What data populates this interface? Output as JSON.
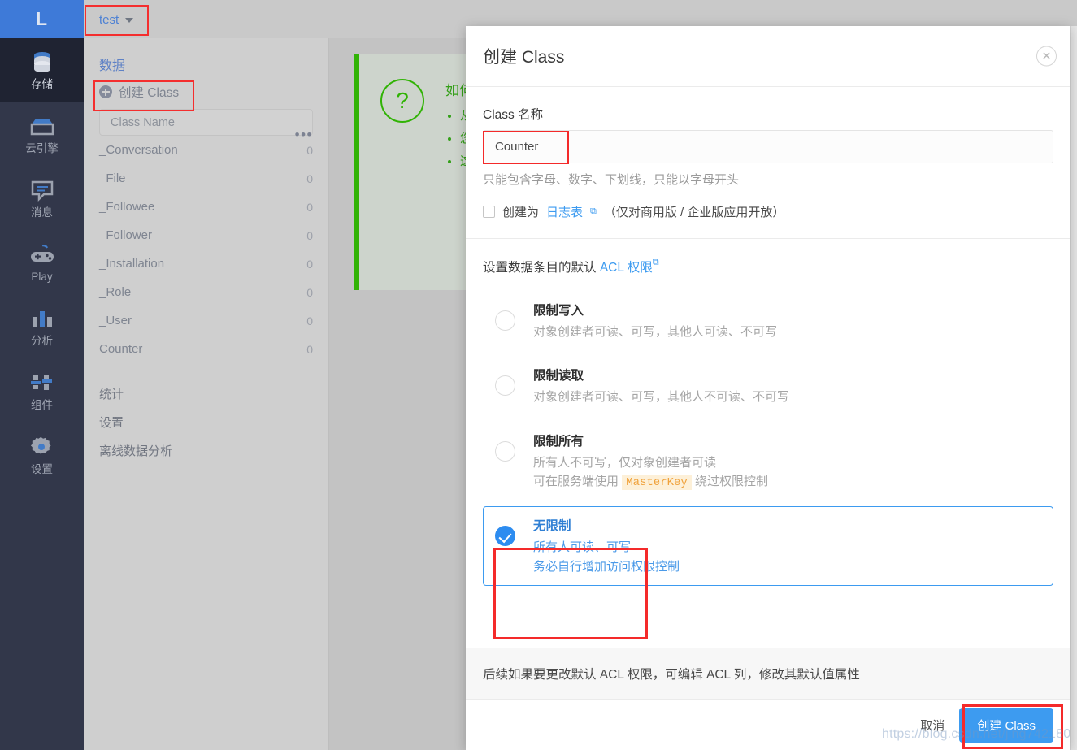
{
  "topbar": {
    "logo_text": "L",
    "app_name": "test"
  },
  "rail": {
    "items": [
      {
        "label": "存储",
        "icon": "database-icon",
        "active": true
      },
      {
        "label": "云引擎",
        "icon": "server-icon",
        "active": false
      },
      {
        "label": "消息",
        "icon": "message-icon",
        "active": false
      },
      {
        "label": "Play",
        "icon": "gamepad-icon",
        "active": false
      },
      {
        "label": "分析",
        "icon": "bar-chart-icon",
        "active": false
      },
      {
        "label": "组件",
        "icon": "sliders-icon",
        "active": false
      },
      {
        "label": "设置",
        "icon": "gear-icon",
        "active": false
      }
    ]
  },
  "listpanel": {
    "title": "数据",
    "create_label": "创建 Class",
    "more_label": "•••",
    "class_name_placeholder": "Class Name",
    "classes": [
      {
        "name": "_Conversation",
        "count": "0"
      },
      {
        "name": "_File",
        "count": "0"
      },
      {
        "name": "_Followee",
        "count": "0"
      },
      {
        "name": "_Follower",
        "count": "0"
      },
      {
        "name": "_Installation",
        "count": "0"
      },
      {
        "name": "_Role",
        "count": "0"
      },
      {
        "name": "_User",
        "count": "0"
      },
      {
        "name": "Counter",
        "count": "0"
      }
    ],
    "sections": [
      {
        "label": "统计"
      },
      {
        "label": "设置"
      },
      {
        "label": "离线数据分析"
      }
    ]
  },
  "helpcard": {
    "icon": "question-mark-icon",
    "heading": "如何",
    "bullets": [
      "从",
      "您",
      "这"
    ]
  },
  "modal": {
    "title": "创建 Class",
    "close_label": "✕",
    "field_label": "Class 名称",
    "class_name_value": "Counter",
    "class_name_placeholder": "Class Name",
    "hint": "只能包含字母、数字、下划线，只能以字母开头",
    "checkbox": {
      "checked": false,
      "prefix": "创建为",
      "link": "日志表",
      "suffix": "（仅对商用版 / 企业版应用开放）"
    },
    "acl": {
      "title_prefix": "设置数据条目的默认",
      "title_link": "ACL 权限",
      "options": [
        {
          "id": "restrict-write",
          "title": "限制写入",
          "lines": [
            "对象创建者可读、可写，其他人可读、不可写"
          ],
          "selected": false
        },
        {
          "id": "restrict-read",
          "title": "限制读取",
          "lines": [
            "对象创建者可读、可写，其他人不可读、不可写"
          ],
          "selected": false
        },
        {
          "id": "restrict-all",
          "title": "限制所有",
          "lines": [
            "所有人不可写，仅对象创建者可读"
          ],
          "code_line": {
            "before": "可在服务端使用",
            "code": "MasterKey",
            "after": "绕过权限控制"
          },
          "selected": false
        },
        {
          "id": "unrestricted",
          "title": "无限制",
          "lines": [
            "所有人可读、可写",
            "务必自行增加访问权限控制"
          ],
          "selected": true
        }
      ]
    },
    "footer_note": "后续如果要更改默认 ACL 权限，可编辑 ACL 列，修改其默认值属性",
    "cancel_label": "取消",
    "submit_label": "创建 Class"
  },
  "watermark": "https://blog.csdn.net/jing742180",
  "colors": {
    "brand_blue": "#3d9bf0",
    "logo_blue": "#3b78d8",
    "rail_bg": "#2e3347",
    "rail_active_bg": "#1b1f2e",
    "highlight_red": "#f42a2a",
    "help_green": "#2db200",
    "code_orange": "#f0a23c"
  }
}
